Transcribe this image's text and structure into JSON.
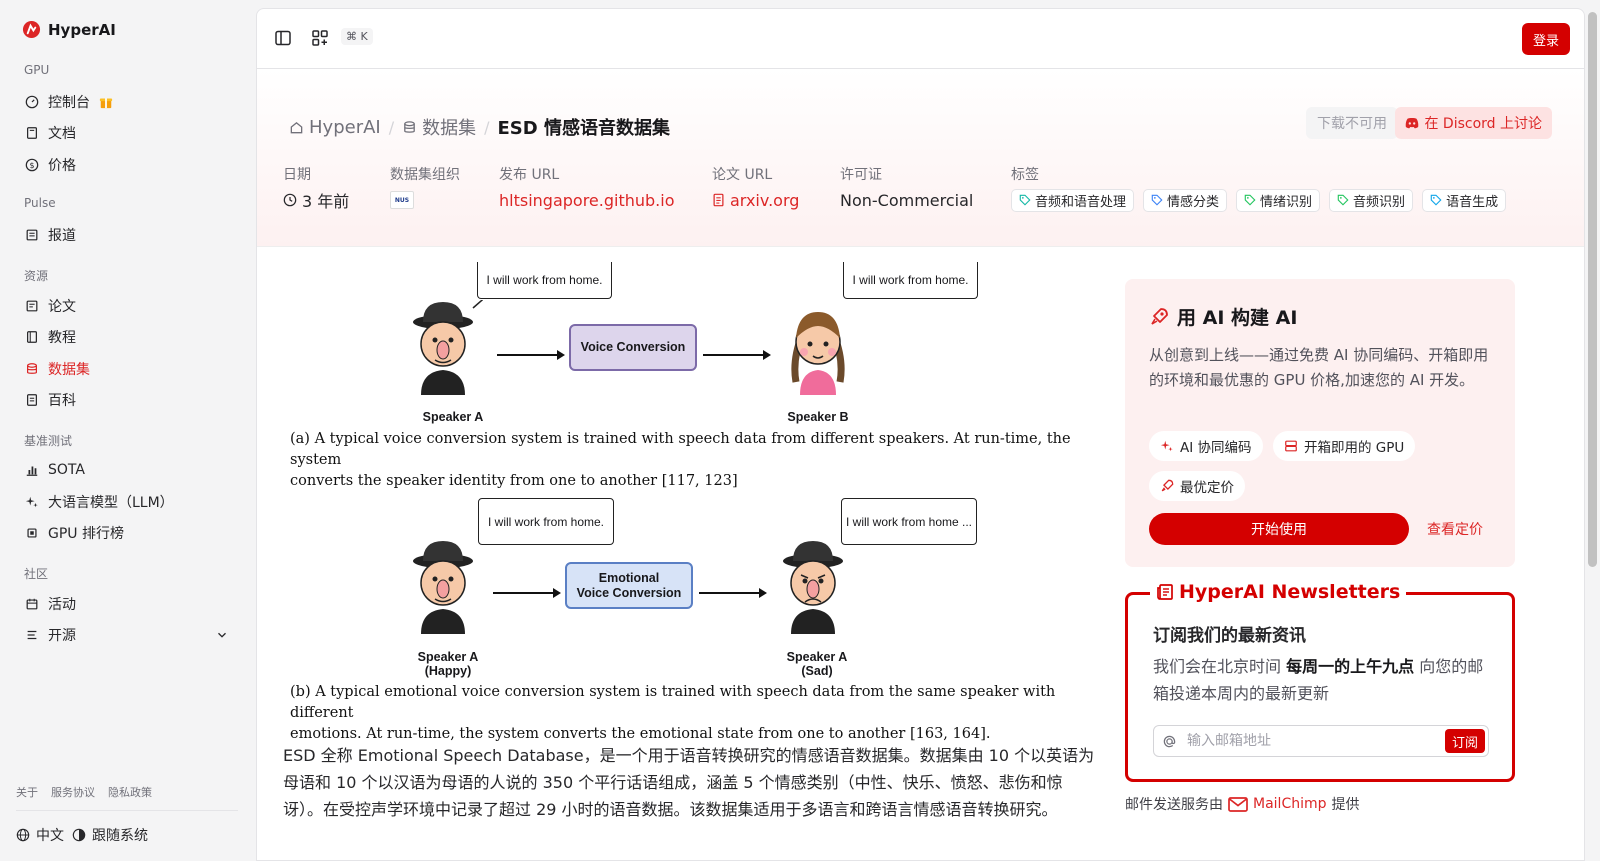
{
  "sidebar": {
    "brand": "HyperAI",
    "sections": {
      "gpu": "GPU",
      "pulse": "Pulse",
      "resources": "资源",
      "benchmark": "基准测试",
      "community": "社区"
    },
    "items": {
      "console": "控制台",
      "docs": "文档",
      "pricing": "价格",
      "news": "报道",
      "papers": "论文",
      "tutorials": "教程",
      "datasets": "数据集",
      "wiki": "百科",
      "sota": "SOTA",
      "llm": "大语言模型（LLM）",
      "gpu_rank": "GPU 排行榜",
      "events": "活动",
      "open_source": "开源"
    },
    "footer": {
      "about": "关于",
      "terms": "服务协议",
      "privacy": "隐私政策",
      "language": "中文",
      "theme": "跟随系统"
    }
  },
  "topbar": {
    "shortcut": "⌘ K",
    "login": "登录"
  },
  "header": {
    "breadcrumb": {
      "home": "HyperAI",
      "datasets": "数据集",
      "current": "ESD 情感语音数据集"
    },
    "download_label": "下载不可用",
    "discord_label": "在 Discord 上讨论",
    "meta": {
      "date_label": "日期",
      "date_value": "3 年前",
      "org_label": "数据集组织",
      "org_logo_text": "NUS",
      "url_label": "发布 URL",
      "url_value": "hltsingapore.github.io",
      "paper_label": "论文 URL",
      "paper_value": "arxiv.org",
      "license_label": "许可证",
      "license_value": "Non-Commercial",
      "tags_label": "标签"
    },
    "tags": [
      "音频和语音处理",
      "情感分类",
      "情绪识别",
      "音频识别",
      "语音生成"
    ]
  },
  "figure": {
    "a": {
      "bubble_left": "I will work from home.",
      "bubble_right": "I will work from home.",
      "box": "Voice Conversion",
      "speaker_left": "Speaker A",
      "speaker_right": "Speaker B",
      "caption_line1": "(a)  A typical voice conversion system is trained with speech data from different speakers. At run-time, the system",
      "caption_line2": "converts the speaker identity from one to another [117, 123]"
    },
    "b": {
      "bubble_left": "I will work from home.",
      "bubble_right": "I will work from home ...",
      "box_line1": "Emotional",
      "box_line2": "Voice Conversion",
      "speaker_left_line1": "Speaker A",
      "speaker_left_line2": "(Happy)",
      "speaker_right_line1": "Speaker A",
      "speaker_right_line2": "(Sad)",
      "caption_line1": "(b)  A typical emotional voice conversion system is trained with speech data from the same speaker with different",
      "caption_line2": "emotions. At run-time, the system converts the emotional state from one to another [163, 164]."
    }
  },
  "description": "ESD 全称 Emotional Speech Database，是一个用于语音转换研究的情感语音数据集。数据集由 10 个以英语为母语和 10 个以汉语为母语的人说的 350 个平行话语组成，涵盖 5 个情感类别（中性、快乐、愤怒、悲伤和惊讶）。在受控声学环境中记录了超过 29 小时的语音数据。该数据集适用于多语言和跨语言情感语音转换研究。",
  "promo": {
    "title": "用 AI 构建 AI",
    "desc": "从创意到上线——通过免费 AI 协同编码、开箱即用的环境和最优惠的 GPU 价格,加速您的 AI 开发。",
    "chip1": "AI 协同编码",
    "chip2": "开箱即用的 GPU",
    "chip3": "最优定价",
    "start": "开始使用",
    "pricing": "查看定价"
  },
  "newsletter": {
    "heading": "HyperAI Newsletters",
    "title": "订阅我们的最新资讯",
    "desc_pre": "我们会在北京时间 ",
    "desc_bold": "每周一的上午九点",
    "desc_post": " 向您的邮箱投递本周内的最新更新",
    "placeholder": "输入邮箱地址",
    "subscribe": "订阅",
    "credit_pre": "邮件发送服务由",
    "credit_brand": "MailChimp",
    "credit_post": "提供"
  },
  "colors": {
    "accent": "#d40000",
    "link": "#dc2626"
  }
}
